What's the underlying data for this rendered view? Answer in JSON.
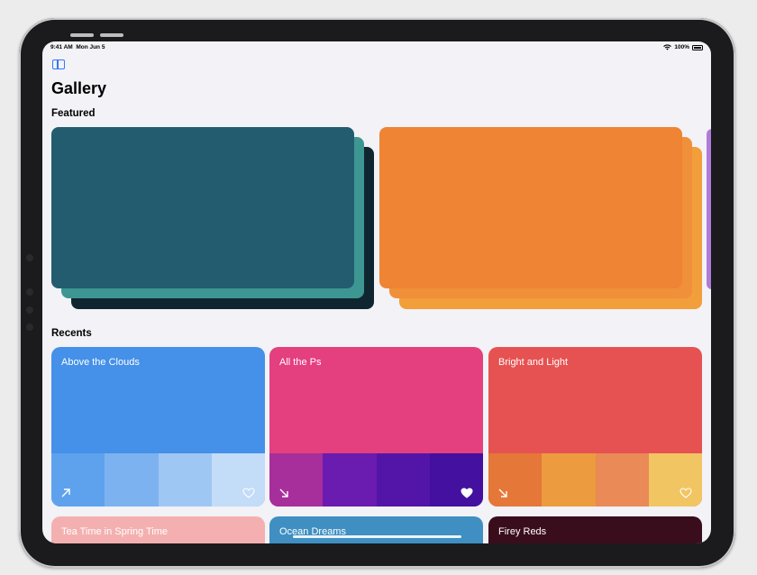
{
  "status_bar": {
    "time": "9:41 AM",
    "date": "Mon Jun 5",
    "battery": "100%"
  },
  "page_title": "Gallery",
  "sections": {
    "featured": "Featured",
    "recents": "Recents"
  },
  "featured": [
    {
      "colors": [
        "#235c6e",
        "#3d9692",
        "#0f2630"
      ]
    },
    {
      "colors": [
        "#ef8434",
        "#f0903a",
        "#f29e3a"
      ]
    }
  ],
  "recents": [
    {
      "name": "Above the Clouds",
      "color": "#4590e8",
      "swatches": [
        "#5ea2ee",
        "#7db2f0",
        "#9fc7f4",
        "#c3dcf8"
      ],
      "liked": false
    },
    {
      "name": "All the Ps",
      "color": "#e43f7f",
      "swatches": [
        "#a72f9c",
        "#6a1bb0",
        "#5315a8",
        "#4310a0"
      ],
      "liked": true
    },
    {
      "name": "Bright and Light",
      "color": "#e65251",
      "swatches": [
        "#e57738",
        "#ec9b3f",
        "#ea8a56",
        "#f2c563"
      ],
      "liked": false
    }
  ],
  "more_recents": [
    {
      "name": "Tea Time in Spring Time",
      "color": "#f4b0b0"
    },
    {
      "name": "Ocean Dreams",
      "color": "#3f8fc2"
    },
    {
      "name": "Firey Reds",
      "color": "#3a0d1c"
    }
  ],
  "icons": {
    "sidebar": "sidebar-icon",
    "expand": "arrow-diagonal-icon",
    "favorite": "heart-icon"
  }
}
